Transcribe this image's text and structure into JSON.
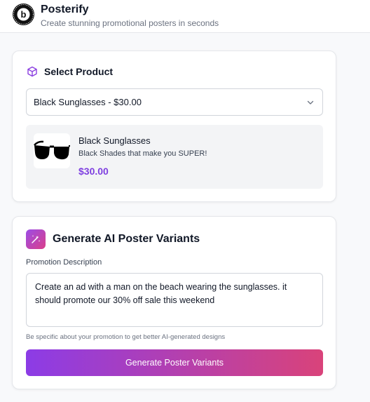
{
  "header": {
    "title": "Posterify",
    "subtitle": "Create stunning promotional posters in seconds",
    "logo_icon": "posterify-logo",
    "logo_letter": "b"
  },
  "product_section": {
    "title": "Select Product",
    "title_icon": "cube-icon",
    "select": {
      "value": "Black Sunglasses - $30.00",
      "icon": "chevron-down-icon"
    },
    "preview": {
      "name": "Black Sunglasses",
      "description": "Black Shades that make you SUPER!",
      "price": "$30.00",
      "image_icon": "sunglasses-image"
    }
  },
  "generate_section": {
    "title": "Generate AI Poster Variants",
    "title_icon": "magic-wand-icon",
    "field_label": "Promotion Description",
    "textarea_value": "Create an ad with a man on the beach wearing the sunglasses. it should promote our 30% off sale this weekend",
    "hint": "Be specific about your promotion to get better AI-generated designs",
    "button_label": "Generate Poster Variants"
  },
  "colors": {
    "accent_purple": "#7e3fe0",
    "gradient_start": "#8c3ce6",
    "gradient_end": "#d9437a"
  }
}
